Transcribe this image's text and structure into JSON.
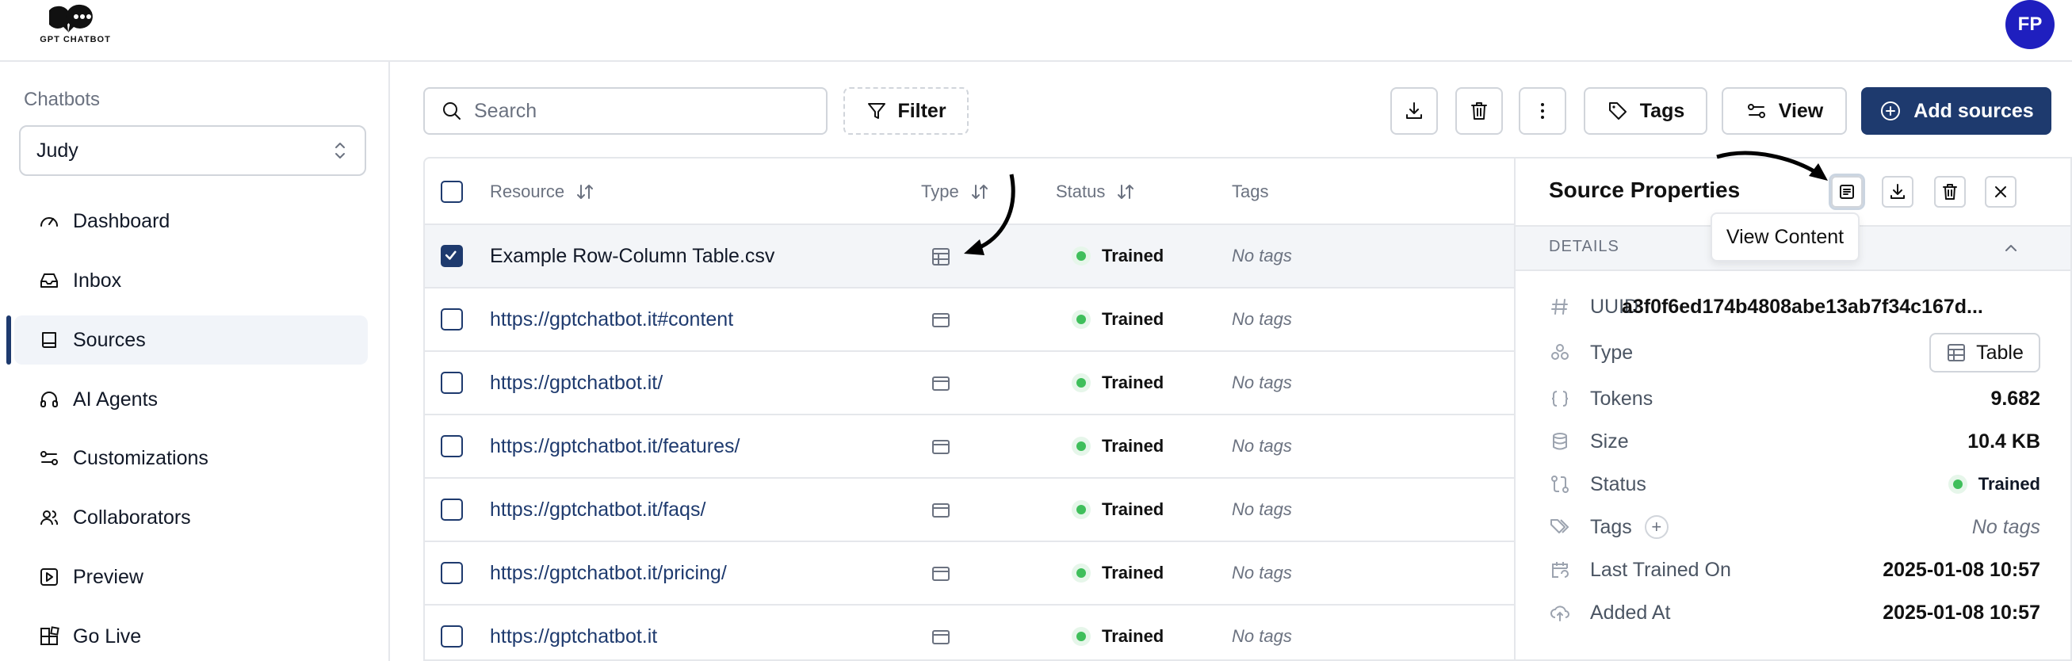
{
  "brand": {
    "logo_text": "GPT CHATBOT"
  },
  "user": {
    "initials": "FP"
  },
  "sidebar": {
    "section_label": "Chatbots",
    "selected_chatbot": "Judy",
    "items": [
      {
        "label": "Dashboard",
        "icon": "gauge-icon"
      },
      {
        "label": "Inbox",
        "icon": "inbox-icon"
      },
      {
        "label": "Sources",
        "icon": "book-icon"
      },
      {
        "label": "AI Agents",
        "icon": "headphones-icon"
      },
      {
        "label": "Customizations",
        "icon": "sliders-icon"
      },
      {
        "label": "Collaborators",
        "icon": "users-icon"
      },
      {
        "label": "Preview",
        "icon": "play-icon"
      },
      {
        "label": "Go Live",
        "icon": "blocks-icon"
      }
    ]
  },
  "toolbar": {
    "search_placeholder": "Search",
    "filter_label": "Filter",
    "tags_label": "Tags",
    "view_label": "View",
    "add_sources_label": "Add sources"
  },
  "table": {
    "columns": {
      "resource": "Resource",
      "type": "Type",
      "status": "Status",
      "tags": "Tags"
    },
    "rows": [
      {
        "resource": "Example Row-Column Table.csv",
        "type": "table",
        "status": "Trained",
        "tags": "No tags",
        "selected": true
      },
      {
        "resource": "https://gptchatbot.it#content",
        "type": "web",
        "status": "Trained",
        "tags": "No tags"
      },
      {
        "resource": "https://gptchatbot.it/",
        "type": "web",
        "status": "Trained",
        "tags": "No tags"
      },
      {
        "resource": "https://gptchatbot.it/features/",
        "type": "web",
        "status": "Trained",
        "tags": "No tags"
      },
      {
        "resource": "https://gptchatbot.it/faqs/",
        "type": "web",
        "status": "Trained",
        "tags": "No tags"
      },
      {
        "resource": "https://gptchatbot.it/pricing/",
        "type": "web",
        "status": "Trained",
        "tags": "No tags"
      },
      {
        "resource": "https://gptchatbot.it",
        "type": "web",
        "status": "Trained",
        "tags": "No tags"
      }
    ]
  },
  "panel": {
    "title": "Source Properties",
    "tooltip": "View Content",
    "section": "DETAILS",
    "props": {
      "uuid_label": "UUID",
      "uuid_value": "a3f0f6ed174b4808abe13ab7f34c167d...",
      "type_label": "Type",
      "type_value": "Table",
      "tokens_label": "Tokens",
      "tokens_value": "9.682",
      "size_label": "Size",
      "size_value": "10.4 KB",
      "status_label": "Status",
      "status_value": "Trained",
      "tags_label": "Tags",
      "tags_value": "No tags",
      "last_trained_label": "Last Trained On",
      "last_trained_value": "2025-01-08 10:57",
      "added_label": "Added At",
      "added_value": "2025-01-08 10:57"
    }
  },
  "colors": {
    "primary": "#1e3a6e",
    "status_green": "#3fbf5b",
    "avatar": "#1f1fbf"
  }
}
